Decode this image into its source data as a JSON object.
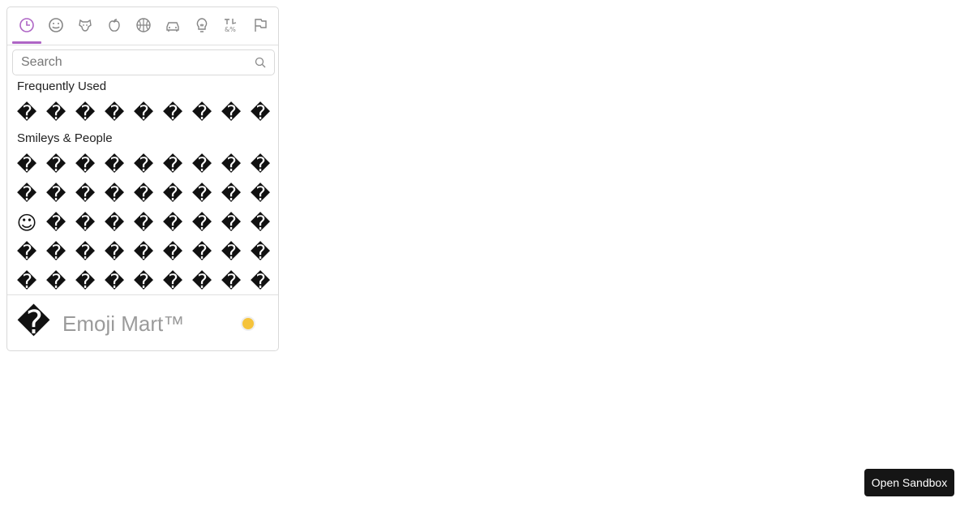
{
  "picker": {
    "anchors": [
      {
        "name": "recent-icon",
        "active": true
      },
      {
        "name": "smiley-icon"
      },
      {
        "name": "dog-icon"
      },
      {
        "name": "apple-icon"
      },
      {
        "name": "basketball-icon"
      },
      {
        "name": "car-icon"
      },
      {
        "name": "lightbulb-icon"
      },
      {
        "name": "symbols-icon"
      },
      {
        "name": "flag-icon"
      }
    ],
    "accent_color": "#ae65c5",
    "search": {
      "placeholder": "Search",
      "value": ""
    },
    "categories": [
      {
        "label": "Frequently Used",
        "emojis": [
          "�",
          "�",
          "�",
          "�",
          "�",
          "�",
          "�",
          "�",
          "�"
        ]
      },
      {
        "label": "Smileys & People",
        "emojis": [
          "�",
          "�",
          "�",
          "�",
          "�",
          "�",
          "�",
          "�",
          "�",
          "�",
          "�",
          "�",
          "�",
          "�",
          "�",
          "�",
          "�",
          "�",
          "☺",
          "�",
          "�",
          "�",
          "�",
          "�",
          "�",
          "�",
          "�",
          "�",
          "�",
          "�",
          "�",
          "�",
          "�",
          "�",
          "�",
          "�",
          "�",
          "�",
          "�",
          "�",
          "�",
          "�",
          "�",
          "�",
          "�"
        ]
      }
    ],
    "preview": {
      "emoji": "�",
      "title": "Emoji Mart™"
    },
    "skin_color": "#f5c33b"
  },
  "sandbox_button": {
    "label": "Open Sandbox"
  }
}
